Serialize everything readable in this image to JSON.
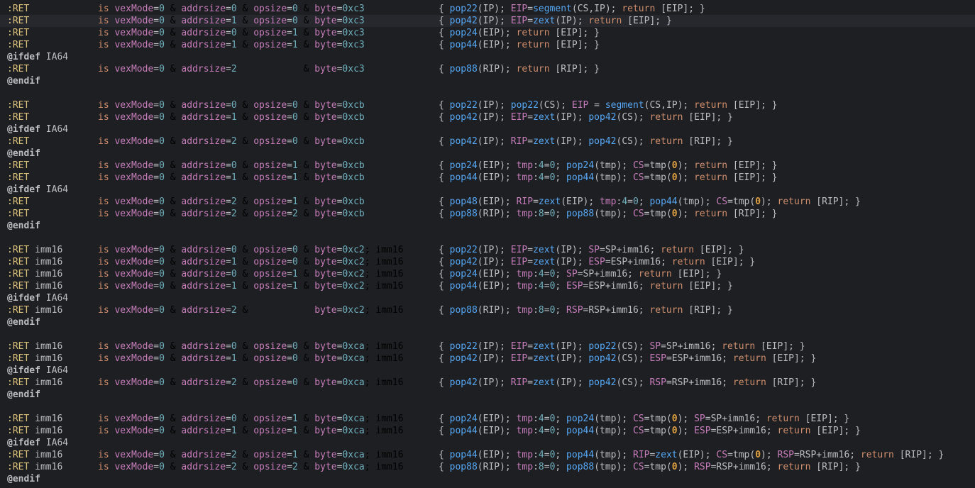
{
  "editor": {
    "highlight_line_index": 1,
    "colors": {
      "background": "#1e1f22",
      "current_line": "#26282e",
      "constructor": "#d8c07a",
      "keyword": "#cf8e6d",
      "field": "#c77dbb",
      "number": "#6fafbd",
      "function": "#56a8f5",
      "text": "#bcbec4",
      "bold_number": "#e0a040"
    },
    "lines": [
      {
        "type": "code",
        "label": ":RET",
        "is": "is vexMode=0 & addrsize=0 & opsize=0 & byte=0xc3",
        "body": "{ pop22(IP); EIP=segment(CS,IP); return [EIP]; }"
      },
      {
        "type": "code",
        "label": ":RET",
        "is": "is vexMode=0 & addrsize=1 & opsize=0 & byte=0xc3",
        "body": "{ pop42(IP); EIP=zext(IP); return [EIP]; }"
      },
      {
        "type": "code",
        "label": ":RET",
        "is": "is vexMode=0 & addrsize=0 & opsize=1 & byte=0xc3",
        "body": "{ pop24(EIP); return [EIP]; }"
      },
      {
        "type": "code",
        "label": ":RET",
        "is": "is vexMode=0 & addrsize=1 & opsize=1 & byte=0xc3",
        "body": "{ pop44(EIP); return [EIP]; }"
      },
      {
        "type": "dir",
        "text": "@ifdef IA64"
      },
      {
        "type": "code",
        "label": ":RET",
        "is": "is vexMode=0 & addrsize=2            & byte=0xc3",
        "body": "{ pop88(RIP); return [RIP]; }"
      },
      {
        "type": "dir",
        "text": "@endif"
      },
      {
        "type": "blank"
      },
      {
        "type": "code",
        "label": ":RET",
        "is": "is vexMode=0 & addrsize=0 & opsize=0 & byte=0xcb",
        "body": "{ pop22(IP); pop22(CS); EIP = segment(CS,IP); return [EIP]; }"
      },
      {
        "type": "code",
        "label": ":RET",
        "is": "is vexMode=0 & addrsize=1 & opsize=0 & byte=0xcb",
        "body": "{ pop42(IP); EIP=zext(IP); pop42(CS); return [EIP]; }"
      },
      {
        "type": "dir",
        "text": "@ifdef IA64"
      },
      {
        "type": "code",
        "label": ":RET",
        "is": "is vexMode=0 & addrsize=2 & opsize=0 & byte=0xcb",
        "body": "{ pop42(IP); RIP=zext(IP); pop42(CS); return [RIP]; }"
      },
      {
        "type": "dir",
        "text": "@endif"
      },
      {
        "type": "code",
        "label": ":RET",
        "is": "is vexMode=0 & addrsize=0 & opsize=1 & byte=0xcb",
        "body": "{ pop24(EIP); tmp:4=0; pop24(tmp); CS=tmp(0); return [EIP]; }"
      },
      {
        "type": "code",
        "label": ":RET",
        "is": "is vexMode=0 & addrsize=1 & opsize=1 & byte=0xcb",
        "body": "{ pop44(EIP); tmp:4=0; pop44(tmp); CS=tmp(0); return [EIP]; }"
      },
      {
        "type": "dir",
        "text": "@ifdef IA64"
      },
      {
        "type": "code",
        "label": ":RET",
        "is": "is vexMode=0 & addrsize=2 & opsize=1 & byte=0xcb",
        "body": "{ pop48(EIP); RIP=zext(EIP); tmp:4=0; pop44(tmp); CS=tmp(0); return [RIP]; }"
      },
      {
        "type": "code",
        "label": ":RET",
        "is": "is vexMode=0 & addrsize=2 & opsize=2 & byte=0xcb",
        "body": "{ pop88(RIP); tmp:8=0; pop88(tmp); CS=tmp(0); return [RIP]; }"
      },
      {
        "type": "dir",
        "text": "@endif"
      },
      {
        "type": "blank"
      },
      {
        "type": "code",
        "label": ":RET imm16",
        "is": "is vexMode=0 & addrsize=0 & opsize=0 & byte=0xc2; imm16",
        "body": "{ pop22(IP); EIP=zext(IP); SP=SP+imm16; return [EIP]; }"
      },
      {
        "type": "code",
        "label": ":RET imm16",
        "is": "is vexMode=0 & addrsize=1 & opsize=0 & byte=0xc2; imm16",
        "body": "{ pop42(IP); EIP=zext(IP); ESP=ESP+imm16; return [EIP]; }"
      },
      {
        "type": "code",
        "label": ":RET imm16",
        "is": "is vexMode=0 & addrsize=0 & opsize=1 & byte=0xc2; imm16",
        "body": "{ pop24(EIP); tmp:4=0; SP=SP+imm16; return [EIP]; }"
      },
      {
        "type": "code",
        "label": ":RET imm16",
        "is": "is vexMode=0 & addrsize=1 & opsize=1 & byte=0xc2; imm16",
        "body": "{ pop44(EIP); tmp:4=0; ESP=ESP+imm16; return [EIP]; }"
      },
      {
        "type": "dir",
        "text": "@ifdef IA64"
      },
      {
        "type": "code",
        "label": ":RET imm16",
        "is": "is vexMode=0 & addrsize=2 &            byte=0xc2; imm16",
        "body": "{ pop88(RIP); tmp:8=0; RSP=RSP+imm16; return [RIP]; }"
      },
      {
        "type": "dir",
        "text": "@endif"
      },
      {
        "type": "blank"
      },
      {
        "type": "code",
        "label": ":RET imm16",
        "is": "is vexMode=0 & addrsize=0 & opsize=0 & byte=0xca; imm16",
        "body": "{ pop22(IP); EIP=zext(IP); pop22(CS); SP=SP+imm16; return [EIP]; }"
      },
      {
        "type": "code",
        "label": ":RET imm16",
        "is": "is vexMode=0 & addrsize=1 & opsize=0 & byte=0xca; imm16",
        "body": "{ pop42(IP); EIP=zext(IP); pop42(CS); ESP=ESP+imm16; return [EIP]; }"
      },
      {
        "type": "dir",
        "text": "@ifdef IA64"
      },
      {
        "type": "code",
        "label": ":RET imm16",
        "is": "is vexMode=0 & addrsize=2 & opsize=0 & byte=0xca; imm16",
        "body": "{ pop42(IP); RIP=zext(IP); pop42(CS); RSP=RSP+imm16; return [RIP]; }"
      },
      {
        "type": "dir",
        "text": "@endif"
      },
      {
        "type": "blank"
      },
      {
        "type": "code",
        "label": ":RET imm16",
        "is": "is vexMode=0 & addrsize=0 & opsize=1 & byte=0xca; imm16",
        "body": "{ pop24(EIP); tmp:4=0; pop24(tmp); CS=tmp(0); SP=SP+imm16; return [EIP]; }"
      },
      {
        "type": "code",
        "label": ":RET imm16",
        "is": "is vexMode=0 & addrsize=1 & opsize=1 & byte=0xca; imm16",
        "body": "{ pop44(EIP); tmp:4=0; pop44(tmp); CS=tmp(0); ESP=ESP+imm16; return [EIP]; }"
      },
      {
        "type": "dir",
        "text": "@ifdef IA64"
      },
      {
        "type": "code",
        "label": ":RET imm16",
        "is": "is vexMode=0 & addrsize=2 & opsize=1 & byte=0xca; imm16",
        "body": "{ pop44(EIP); tmp:4=0; pop44(tmp); RIP=zext(EIP); CS=tmp(0); RSP=RSP+imm16; return [RIP]; }"
      },
      {
        "type": "code",
        "label": ":RET imm16",
        "is": "is vexMode=0 & addrsize=2 & opsize=2 & byte=0xca; imm16",
        "body": "{ pop88(RIP); tmp:8=0; pop88(tmp); CS=tmp(0); RSP=RSP+imm16; return [RIP]; }"
      },
      {
        "type": "dir",
        "text": "@endif"
      }
    ]
  }
}
